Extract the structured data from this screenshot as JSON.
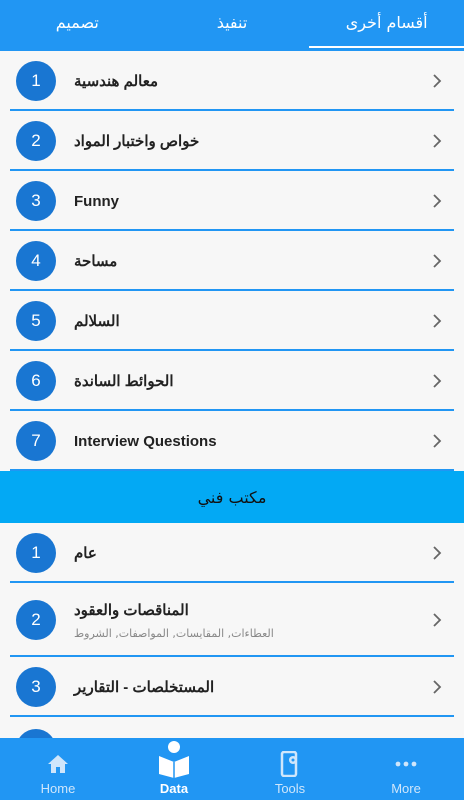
{
  "tabs": [
    {
      "label": "أقسام أخرى",
      "active": true
    },
    {
      "label": "تنفيذ",
      "active": false
    },
    {
      "label": "تصميم",
      "active": false
    }
  ],
  "list1": [
    {
      "num": "1",
      "title": "معالم هندسية"
    },
    {
      "num": "2",
      "title": "خواص واختبار المواد"
    },
    {
      "num": "3",
      "title": "Funny"
    },
    {
      "num": "4",
      "title": "مساحة"
    },
    {
      "num": "5",
      "title": "السلالم"
    },
    {
      "num": "6",
      "title": "الحوائط الساندة"
    },
    {
      "num": "7",
      "title": "Interview Questions"
    }
  ],
  "section": {
    "title": "مكتب فني"
  },
  "list2": [
    {
      "num": "1",
      "title": "عام",
      "subtitle": ""
    },
    {
      "num": "2",
      "title": "المناقصات والعقود",
      "subtitle": "العطاءات, المقايسات, المواصفات, الشروط"
    },
    {
      "num": "3",
      "title": "المستخلصات - التقارير",
      "subtitle": ""
    }
  ],
  "bottom_nav": [
    {
      "label": "Home",
      "icon": "home-icon",
      "active": false
    },
    {
      "label": "Data",
      "icon": "book-reader-icon",
      "active": true
    },
    {
      "label": "Tools",
      "icon": "phone-settings-icon",
      "active": false
    },
    {
      "label": "More",
      "icon": "more-dots-icon",
      "active": false
    }
  ],
  "colors": {
    "primary": "#2196f3",
    "badge": "#1976d2",
    "section": "#03a9f4"
  }
}
